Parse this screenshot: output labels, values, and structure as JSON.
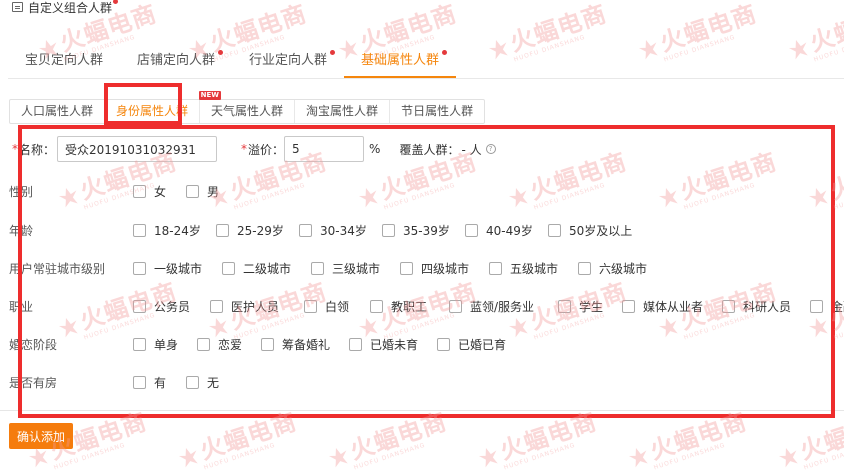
{
  "page_title": "自定义组合人群",
  "main_tabs": [
    {
      "label": "宝贝定向人群",
      "dot": false,
      "active": false
    },
    {
      "label": "店铺定向人群",
      "dot": true,
      "active": false
    },
    {
      "label": "行业定向人群",
      "dot": true,
      "active": false
    },
    {
      "label": "基础属性人群",
      "dot": true,
      "active": true
    }
  ],
  "sub_tabs": [
    {
      "label": "人口属性人群",
      "active": false
    },
    {
      "label": "身份属性人群",
      "active": true,
      "badge": "NEW"
    },
    {
      "label": "天气属性人群",
      "active": false
    },
    {
      "label": "淘宝属性人群",
      "active": false
    },
    {
      "label": "节日属性人群",
      "active": false
    }
  ],
  "form": {
    "name_label": "名称：",
    "name_value": "受众20191031032931",
    "premium_label": "溢价：",
    "premium_value": "5",
    "premium_unit": "%",
    "coverage_label": "覆盖人群：",
    "coverage_value": "- 人",
    "help_glyph": "?",
    "required_mark": "*"
  },
  "rows": [
    {
      "label": "性别",
      "options": [
        "女",
        "男"
      ]
    },
    {
      "label": "年龄",
      "options": [
        "18-24岁",
        "25-29岁",
        "30-34岁",
        "35-39岁",
        "40-49岁",
        "50岁及以上"
      ]
    },
    {
      "label": "用户常驻城市级别",
      "options": [
        "一级城市",
        "二级城市",
        "三级城市",
        "四级城市",
        "五级城市",
        "六级城市"
      ]
    },
    {
      "label": "职业",
      "options": [
        "公务员",
        "医护人员",
        "白领",
        "教职工",
        "蓝领/服务业",
        "学生",
        "媒体从业者",
        "科研人员",
        "金融从业者"
      ]
    },
    {
      "label": "婚恋阶段",
      "options": [
        "单身",
        "恋爱",
        "筹备婚礼",
        "已婚未育",
        "已婚已育"
      ]
    },
    {
      "label": "是否有房",
      "options": [
        "有",
        "无"
      ]
    }
  ],
  "confirm_button": "确认添加",
  "watermark": {
    "text": "火蝠电商",
    "subtext": "HUOFU DIANSHANG"
  },
  "colors": {
    "accent": "#f5860d",
    "highlight": "#ee2d2d",
    "dot": "#e4393c",
    "watermark": "#f39a9a"
  }
}
